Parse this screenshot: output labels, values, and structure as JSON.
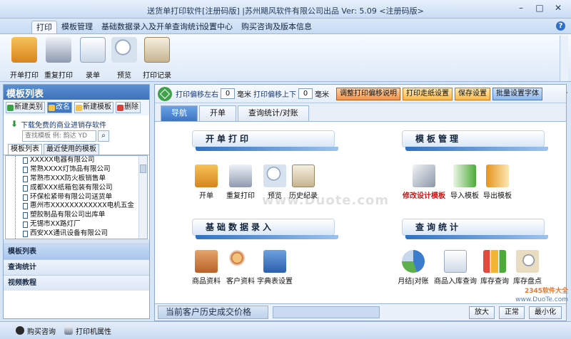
{
  "window": {
    "title": "送货单打印软件[注册码版] |苏州飓风软件有限公司出品  Ver: 5.09  <注册码版>",
    "min": "–",
    "max": "□",
    "close": "✕"
  },
  "ribbon_tabs": [
    "打印",
    "模板管理",
    "基础数据录入及开单查询统计",
    "设置中心",
    "购买咨询及版本信息"
  ],
  "ribbon_buttons": [
    {
      "label": "开单打印",
      "icon": "cashier-icon",
      "color": "#e89b2e"
    },
    {
      "label": "重复打印",
      "icon": "printer-icon",
      "color": "#8e9ab0"
    },
    {
      "label": "录单",
      "icon": "clipboard-icon",
      "color": "#c8d6e6"
    },
    {
      "label": "预览",
      "icon": "magnifier-icon",
      "color": "#d7e2ef"
    },
    {
      "label": "打印记录",
      "icon": "checklist-icon",
      "color": "#c7b48f"
    }
  ],
  "left": {
    "header": "模板列表",
    "buttons": [
      "新建类别",
      "改名",
      "新建模板",
      "删除"
    ],
    "download_link": "下载免费的商业进销存软件",
    "search_placeholder": "查找模板 例: 韵达 YD",
    "tabs": [
      "模板列表",
      "最近使用的模板"
    ],
    "tree_items": [
      "XXXXX电器有限公司",
      "常熟XXXX灯饰品有限公司",
      "常熟市XXX防火板销售单",
      "成都XXX纸箱包装有限公司",
      "环保松紧带有限公司送货单",
      "惠州市XXXXXXXXXXXX电机五金",
      "塑胶制品有限公司出库单",
      "无锡市XX路灯厂",
      "西安XX通讯设备有限公司"
    ],
    "nav": [
      "模板列表",
      "查询统计",
      "视频教程"
    ]
  },
  "toolbar": {
    "offset_lr_label": "打印偏移左右",
    "offset_lr_value": "0",
    "unit1": "毫米",
    "offset_ud_label": "打印偏移上下",
    "offset_ud_value": "0",
    "unit2": "毫米",
    "btn_help": "调整打印偏移说明",
    "btn_paper": "打印走纸设置",
    "btn_save": "保存设置",
    "btn_font": "批量设置字体"
  },
  "content_tabs": [
    "导航",
    "开单",
    "查询统计/对账"
  ],
  "sections": {
    "billing": {
      "title": "开单打印",
      "items": [
        "开单",
        "重复打印",
        "预览",
        "历史纪录"
      ]
    },
    "template": {
      "title": "模板管理",
      "items": [
        "修改设计模板",
        "导入模板",
        "导出模板"
      ]
    },
    "basic": {
      "title": "基础数据录入",
      "items": [
        "商品资料",
        "客户资料",
        "字典表设置"
      ]
    },
    "query": {
      "title": "查询统计",
      "items": [
        "月结|对账",
        "商品入库查询",
        "库存查询",
        "库存盘点"
      ]
    }
  },
  "watermark": "www.Duote.com",
  "status": {
    "caption": "当前客户历史成交价格",
    "zoom_in": "放大",
    "normal": "正常",
    "minimize": "最小化"
  },
  "bottom": {
    "buy": "购买咨询",
    "printer": "打印机属性"
  },
  "corner_watermark": [
    "2345软件大全",
    "www.DuoTe.com"
  ]
}
